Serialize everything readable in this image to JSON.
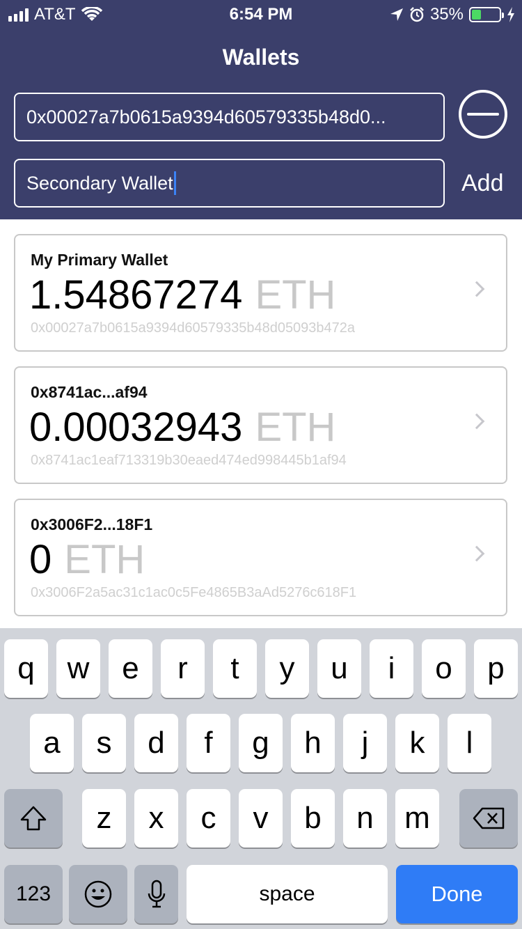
{
  "status_bar": {
    "carrier": "AT&T",
    "time": "6:54 PM",
    "battery_pct": "35%",
    "battery_level": 0.35,
    "battery_color": "#4cd964"
  },
  "header": {
    "title": "Wallets",
    "address_field_value": "0x00027a7b0615a9394d60579335b48d0...",
    "name_field_value": "Secondary Wallet",
    "add_label": "Add",
    "background": "#3b3f6b"
  },
  "wallets": [
    {
      "name": "My Primary Wallet",
      "amount": "1.54867274",
      "unit": "ETH",
      "address": "0x00027a7b0615a9394d60579335b48d05093b472a"
    },
    {
      "name": "0x8741ac...af94",
      "amount": "0.00032943",
      "unit": "ETH",
      "address": "0x8741ac1eaf713319b30eaed474ed998445b1af94"
    },
    {
      "name": "0x3006F2...18F1",
      "amount": "0",
      "unit": "ETH",
      "address": "0x3006F2a5ac31c1ac0c5Fe4865B3aAd5276c618F1"
    }
  ],
  "keyboard": {
    "row1": [
      "q",
      "w",
      "e",
      "r",
      "t",
      "y",
      "u",
      "i",
      "o",
      "p"
    ],
    "row2": [
      "a",
      "s",
      "d",
      "f",
      "g",
      "h",
      "j",
      "k",
      "l"
    ],
    "row3": [
      "z",
      "x",
      "c",
      "v",
      "b",
      "n",
      "m"
    ],
    "numbers_label": "123",
    "space_label": "space",
    "done_label": "Done",
    "done_color": "#2f7cf6"
  }
}
